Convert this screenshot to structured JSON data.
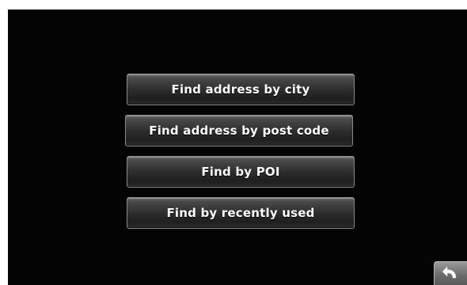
{
  "menu": {
    "items": [
      {
        "label": "Find address by city"
      },
      {
        "label": "Find address by post code"
      },
      {
        "label": "Find by POI"
      },
      {
        "label": "Find by recently used"
      }
    ]
  },
  "back_button": {
    "icon": "back-arrow-icon"
  },
  "colors": {
    "background": "#040404",
    "button_text": "#ffffff",
    "button_border": "#8a8a8a"
  }
}
